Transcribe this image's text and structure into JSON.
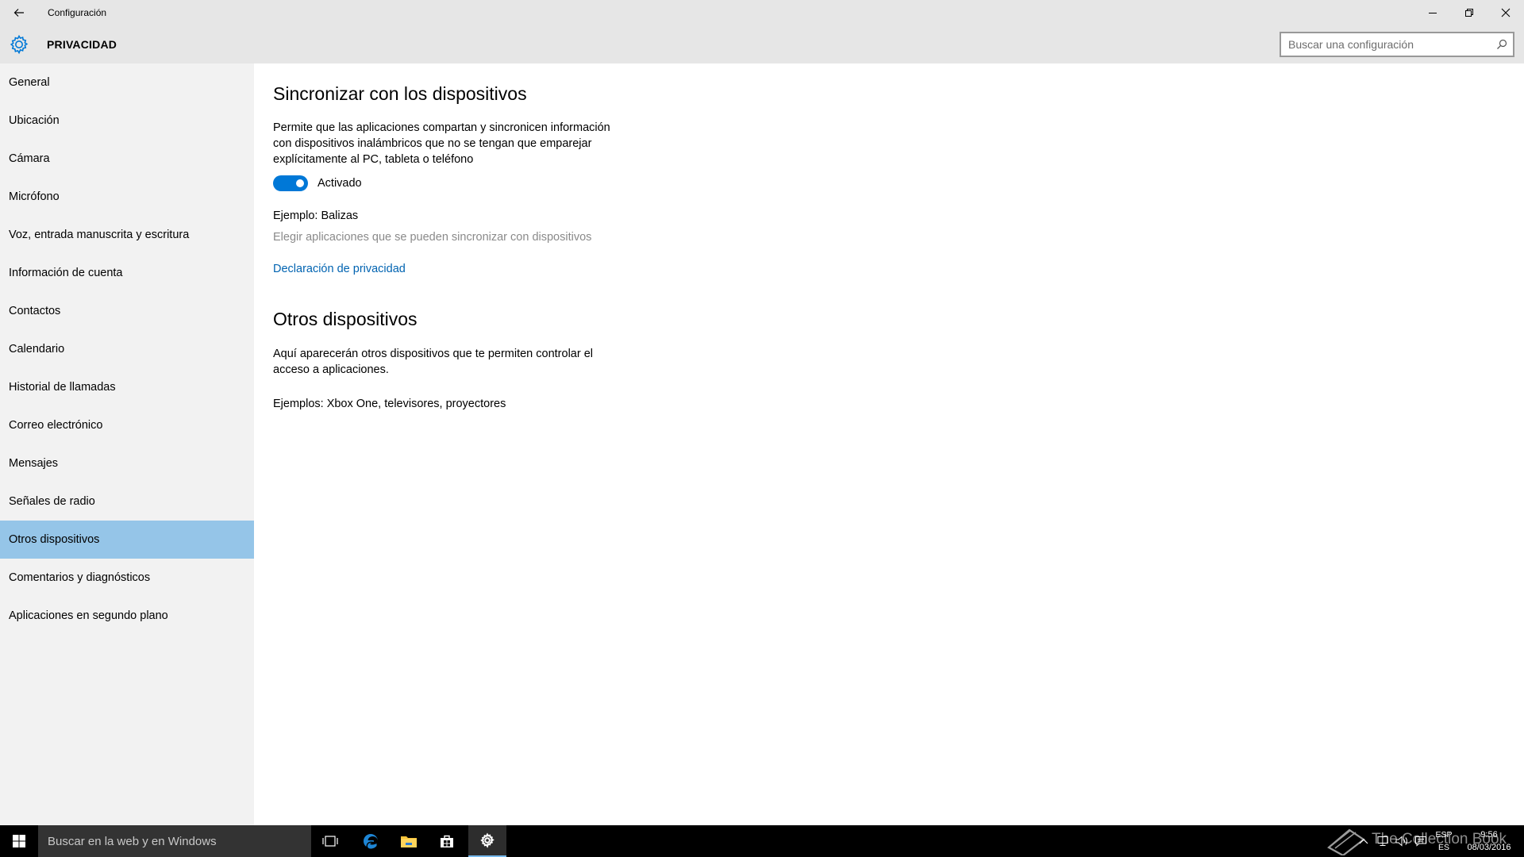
{
  "window": {
    "title": "Configuración"
  },
  "header": {
    "section_title": "PRIVACIDAD",
    "search_placeholder": "Buscar una configuración"
  },
  "sidebar": {
    "items": [
      {
        "label": "General"
      },
      {
        "label": "Ubicación"
      },
      {
        "label": "Cámara"
      },
      {
        "label": "Micrófono"
      },
      {
        "label": "Voz, entrada manuscrita y escritura"
      },
      {
        "label": "Información de cuenta"
      },
      {
        "label": "Contactos"
      },
      {
        "label": "Calendario"
      },
      {
        "label": "Historial de llamadas"
      },
      {
        "label": "Correo electrónico"
      },
      {
        "label": "Mensajes"
      },
      {
        "label": "Señales de radio"
      },
      {
        "label": "Otros dispositivos",
        "selected": true
      },
      {
        "label": "Comentarios y diagnósticos"
      },
      {
        "label": "Aplicaciones en segundo plano"
      }
    ]
  },
  "content": {
    "sync": {
      "heading": "Sincronizar con los dispositivos",
      "description": "Permite que las aplicaciones compartan y sincronicen información con dispositivos inalámbricos que no se tengan que emparejar explícitamente al PC, tableta o teléfono",
      "toggle_state": "Activado",
      "toggle_on": true,
      "example": "Ejemplo: Balizas",
      "choose_apps": "Elegir aplicaciones que se pueden sincronizar con dispositivos",
      "privacy_link": "Declaración de privacidad"
    },
    "other": {
      "heading": "Otros dispositivos",
      "description": "Aquí aparecerán otros dispositivos que te permiten controlar el acceso a aplicaciones.",
      "examples": "Ejemplos: Xbox One, televisores, proyectores"
    }
  },
  "taskbar": {
    "search_placeholder": "Buscar en la web y en Windows",
    "watermark": "The Collection Book",
    "lang_top": "ESP",
    "lang_bottom": "ES",
    "time": "9:56",
    "date": "08/03/2016"
  },
  "colors": {
    "accent": "#0078d7",
    "selected_nav": "#95c5e8",
    "link": "#0063b1",
    "sidebar_bg": "#f2f2f2",
    "titlebar_bg": "#e6e6e6"
  },
  "icons": [
    "back-arrow-icon",
    "minimize-icon",
    "restore-icon",
    "close-icon",
    "gear-icon",
    "search-icon",
    "windows-logo-icon",
    "task-view-icon",
    "edge-icon",
    "file-explorer-icon",
    "store-icon",
    "settings-icon",
    "chevron-up-icon",
    "network-icon",
    "volume-icon",
    "action-center-icon",
    "book-icon"
  ]
}
